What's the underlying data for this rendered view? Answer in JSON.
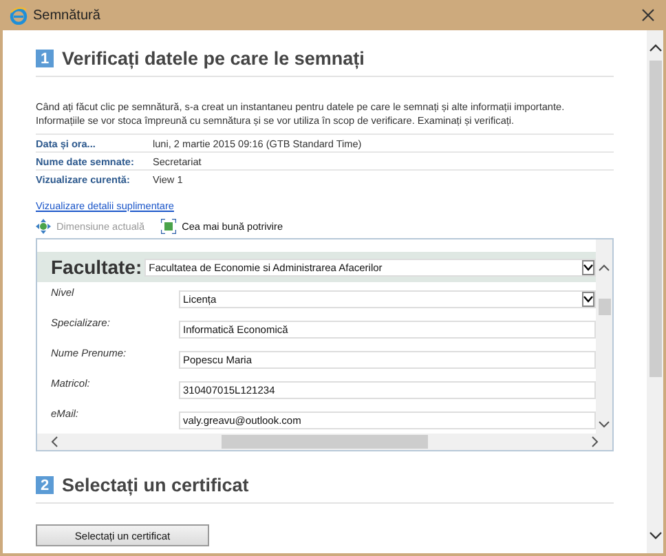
{
  "window": {
    "title": "Semnătură"
  },
  "sections": [
    {
      "number": "1",
      "title": "Verificați datele pe care le semnați"
    },
    {
      "number": "2",
      "title": "Selectați un certificat"
    }
  ],
  "intro": "Când ați făcut clic pe semnătură, s-a creat un instantaneu pentru datele pe care le semnați și alte informații importante. Informațiile se vor stoca împreună cu semnătura și se vor utiliza în scop de verificare. Examinați și verificați.",
  "details": [
    {
      "label": "Data și ora...",
      "value": "luni, 2 martie 2015 09:16 (GTB Standard Time)"
    },
    {
      "label": "Nume date semnate:",
      "value": "Secretariat"
    },
    {
      "label": "Vizualizare curentă:",
      "value": "View 1"
    }
  ],
  "more_link": "Vizualizare detalii suplimentare",
  "toolbar": [
    {
      "label": "Dimensiune actuală",
      "disabled": true,
      "kind": "actual"
    },
    {
      "label": "Cea mai bună potrivire",
      "disabled": false,
      "kind": "fit"
    }
  ],
  "form": {
    "header": {
      "label": "Facultate:",
      "value": "Facultatea de Economie si Administrarea Afacerilor"
    },
    "fields": [
      {
        "label": "Nivel",
        "value": "Licența",
        "kind": "select"
      },
      {
        "label": "Specializare:",
        "value": "Informatică Economică",
        "kind": "text"
      },
      {
        "label": "Nume Prenume:",
        "value": "Popescu Maria",
        "kind": "text"
      },
      {
        "label": "Matricol:",
        "value": "310407015L121234",
        "kind": "text"
      },
      {
        "label": "eMail:",
        "value": "valy.greavu@outlook.com",
        "kind": "text"
      }
    ]
  },
  "button": "Selectați un certificat"
}
